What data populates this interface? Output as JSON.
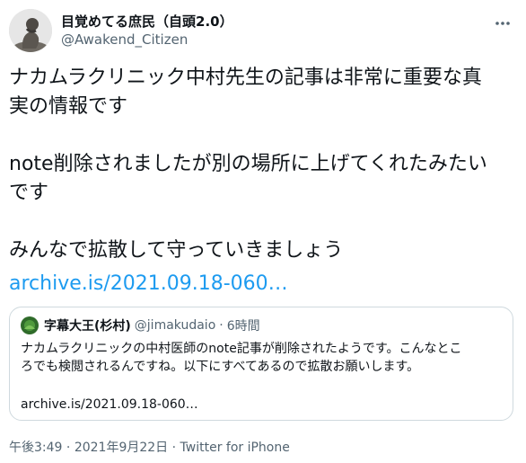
{
  "author": {
    "display_name": "目覚めてる庶民（自頭2.0）",
    "handle": "@Awakend_Citizen"
  },
  "tweet": {
    "text": "ナカムラクリニック中村先生の記事は非常に重要な真\n実の情報です\n\nnote削除されましたが別の場所に上げてくれたみたい\nです\n\nみんなで拡散して守っていきましょう",
    "link": "archive.is/2021.09.18-060…"
  },
  "quoted_tweet": {
    "display_name": "字幕大王(杉村)",
    "handle": "@jimakudaio",
    "separator": "·",
    "time": "6時間",
    "text": "ナカムラクリニックの中村医師のnote記事が削除されたようです。こんなとこ\nろでも検閲されるんですね。以下にすべてあるので拡散お願いします。",
    "link": "archive.is/2021.09.18-060…"
  },
  "meta": {
    "time": "午後3:49",
    "separator": "·",
    "date": "2021年9月22日",
    "source": "Twitter for iPhone"
  },
  "icons": [
    "more-icon"
  ],
  "colors": {
    "link": "#1d9bf0",
    "secondary_text": "#536471",
    "border": "#cfd9de"
  }
}
